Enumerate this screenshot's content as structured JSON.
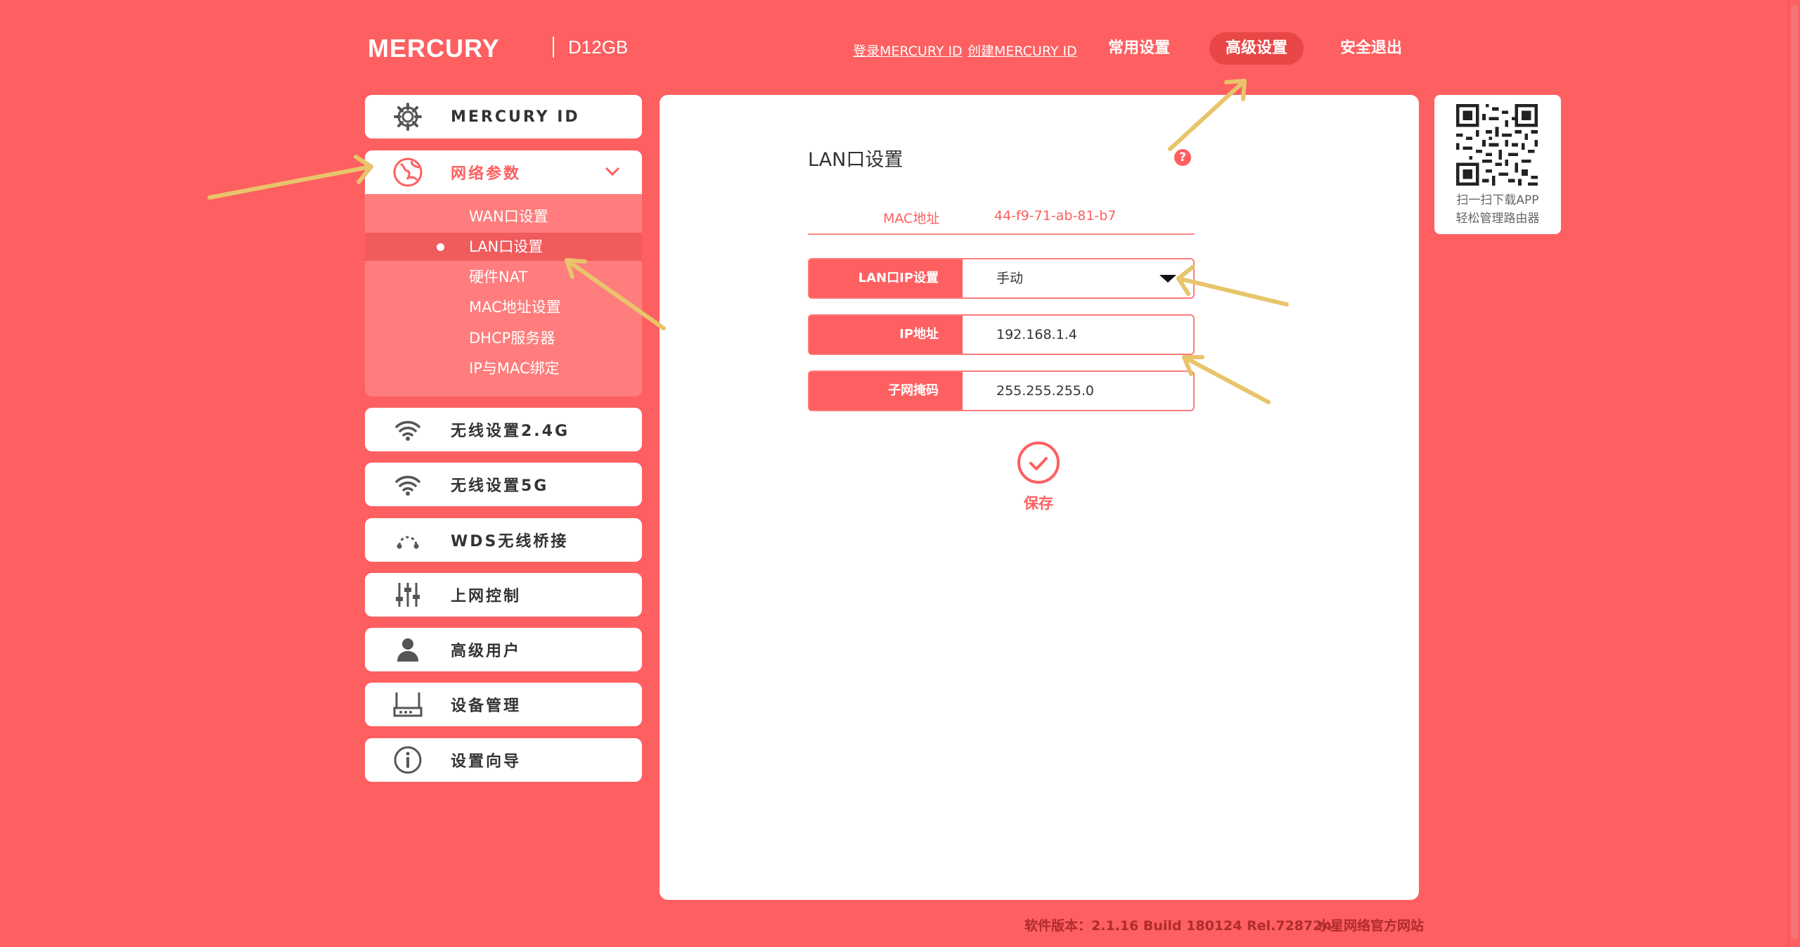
{
  "header": {
    "brand": "MERCURY",
    "model": "D12GB",
    "links": [
      "登录MERCURY ID",
      "创建MERCURY ID"
    ],
    "nav": [
      {
        "label": "常用设置",
        "active": false
      },
      {
        "label": "高级设置",
        "active": true
      },
      {
        "label": "安全退出",
        "active": false
      }
    ]
  },
  "sidebar": {
    "items": [
      {
        "label": "MERCURY ID",
        "icon": "gear-icon"
      },
      {
        "label": "网络参数",
        "icon": "globe-icon",
        "expanded": true
      },
      {
        "label": "无线设置2.4G",
        "icon": "wifi-icon"
      },
      {
        "label": "无线设置5G",
        "icon": "wifi-icon"
      },
      {
        "label": "WDS无线桥接",
        "icon": "bridge-icon"
      },
      {
        "label": "上网控制",
        "icon": "sliders-icon"
      },
      {
        "label": "高级用户",
        "icon": "user-icon"
      },
      {
        "label": "设备管理",
        "icon": "router-icon"
      },
      {
        "label": "设置向导",
        "icon": "info-icon"
      }
    ],
    "submenu": [
      {
        "label": "WAN口设置",
        "active": false
      },
      {
        "label": "LAN口设置",
        "active": true
      },
      {
        "label": "硬件NAT",
        "active": false
      },
      {
        "label": "MAC地址设置",
        "active": false
      },
      {
        "label": "DHCP服务器",
        "active": false
      },
      {
        "label": "IP与MAC绑定",
        "active": false
      }
    ]
  },
  "main": {
    "title": "LAN口设置",
    "help_icon": "?",
    "mac_label": "MAC地址",
    "mac_value": "44-f9-71-ab-81-b7",
    "fields": [
      {
        "label": "LAN口IP设置",
        "value": "手动",
        "type": "select"
      },
      {
        "label": "IP地址",
        "value": "192.168.1.4",
        "type": "input"
      },
      {
        "label": "子网掩码",
        "value": "255.255.255.0",
        "type": "input"
      }
    ],
    "save_label": "保存"
  },
  "qr": {
    "line1": "扫一扫下载APP",
    "line2": "轻松管理路由器"
  },
  "footer": {
    "version": "软件版本：2.1.16 Build 180124 Rel.72872n",
    "site": "水星网络官方网站"
  },
  "colors": {
    "background": "#fe5f60",
    "panel": "#ffffff",
    "accent": "#fe5f60",
    "annotation_arrow": "#e8c46a"
  }
}
